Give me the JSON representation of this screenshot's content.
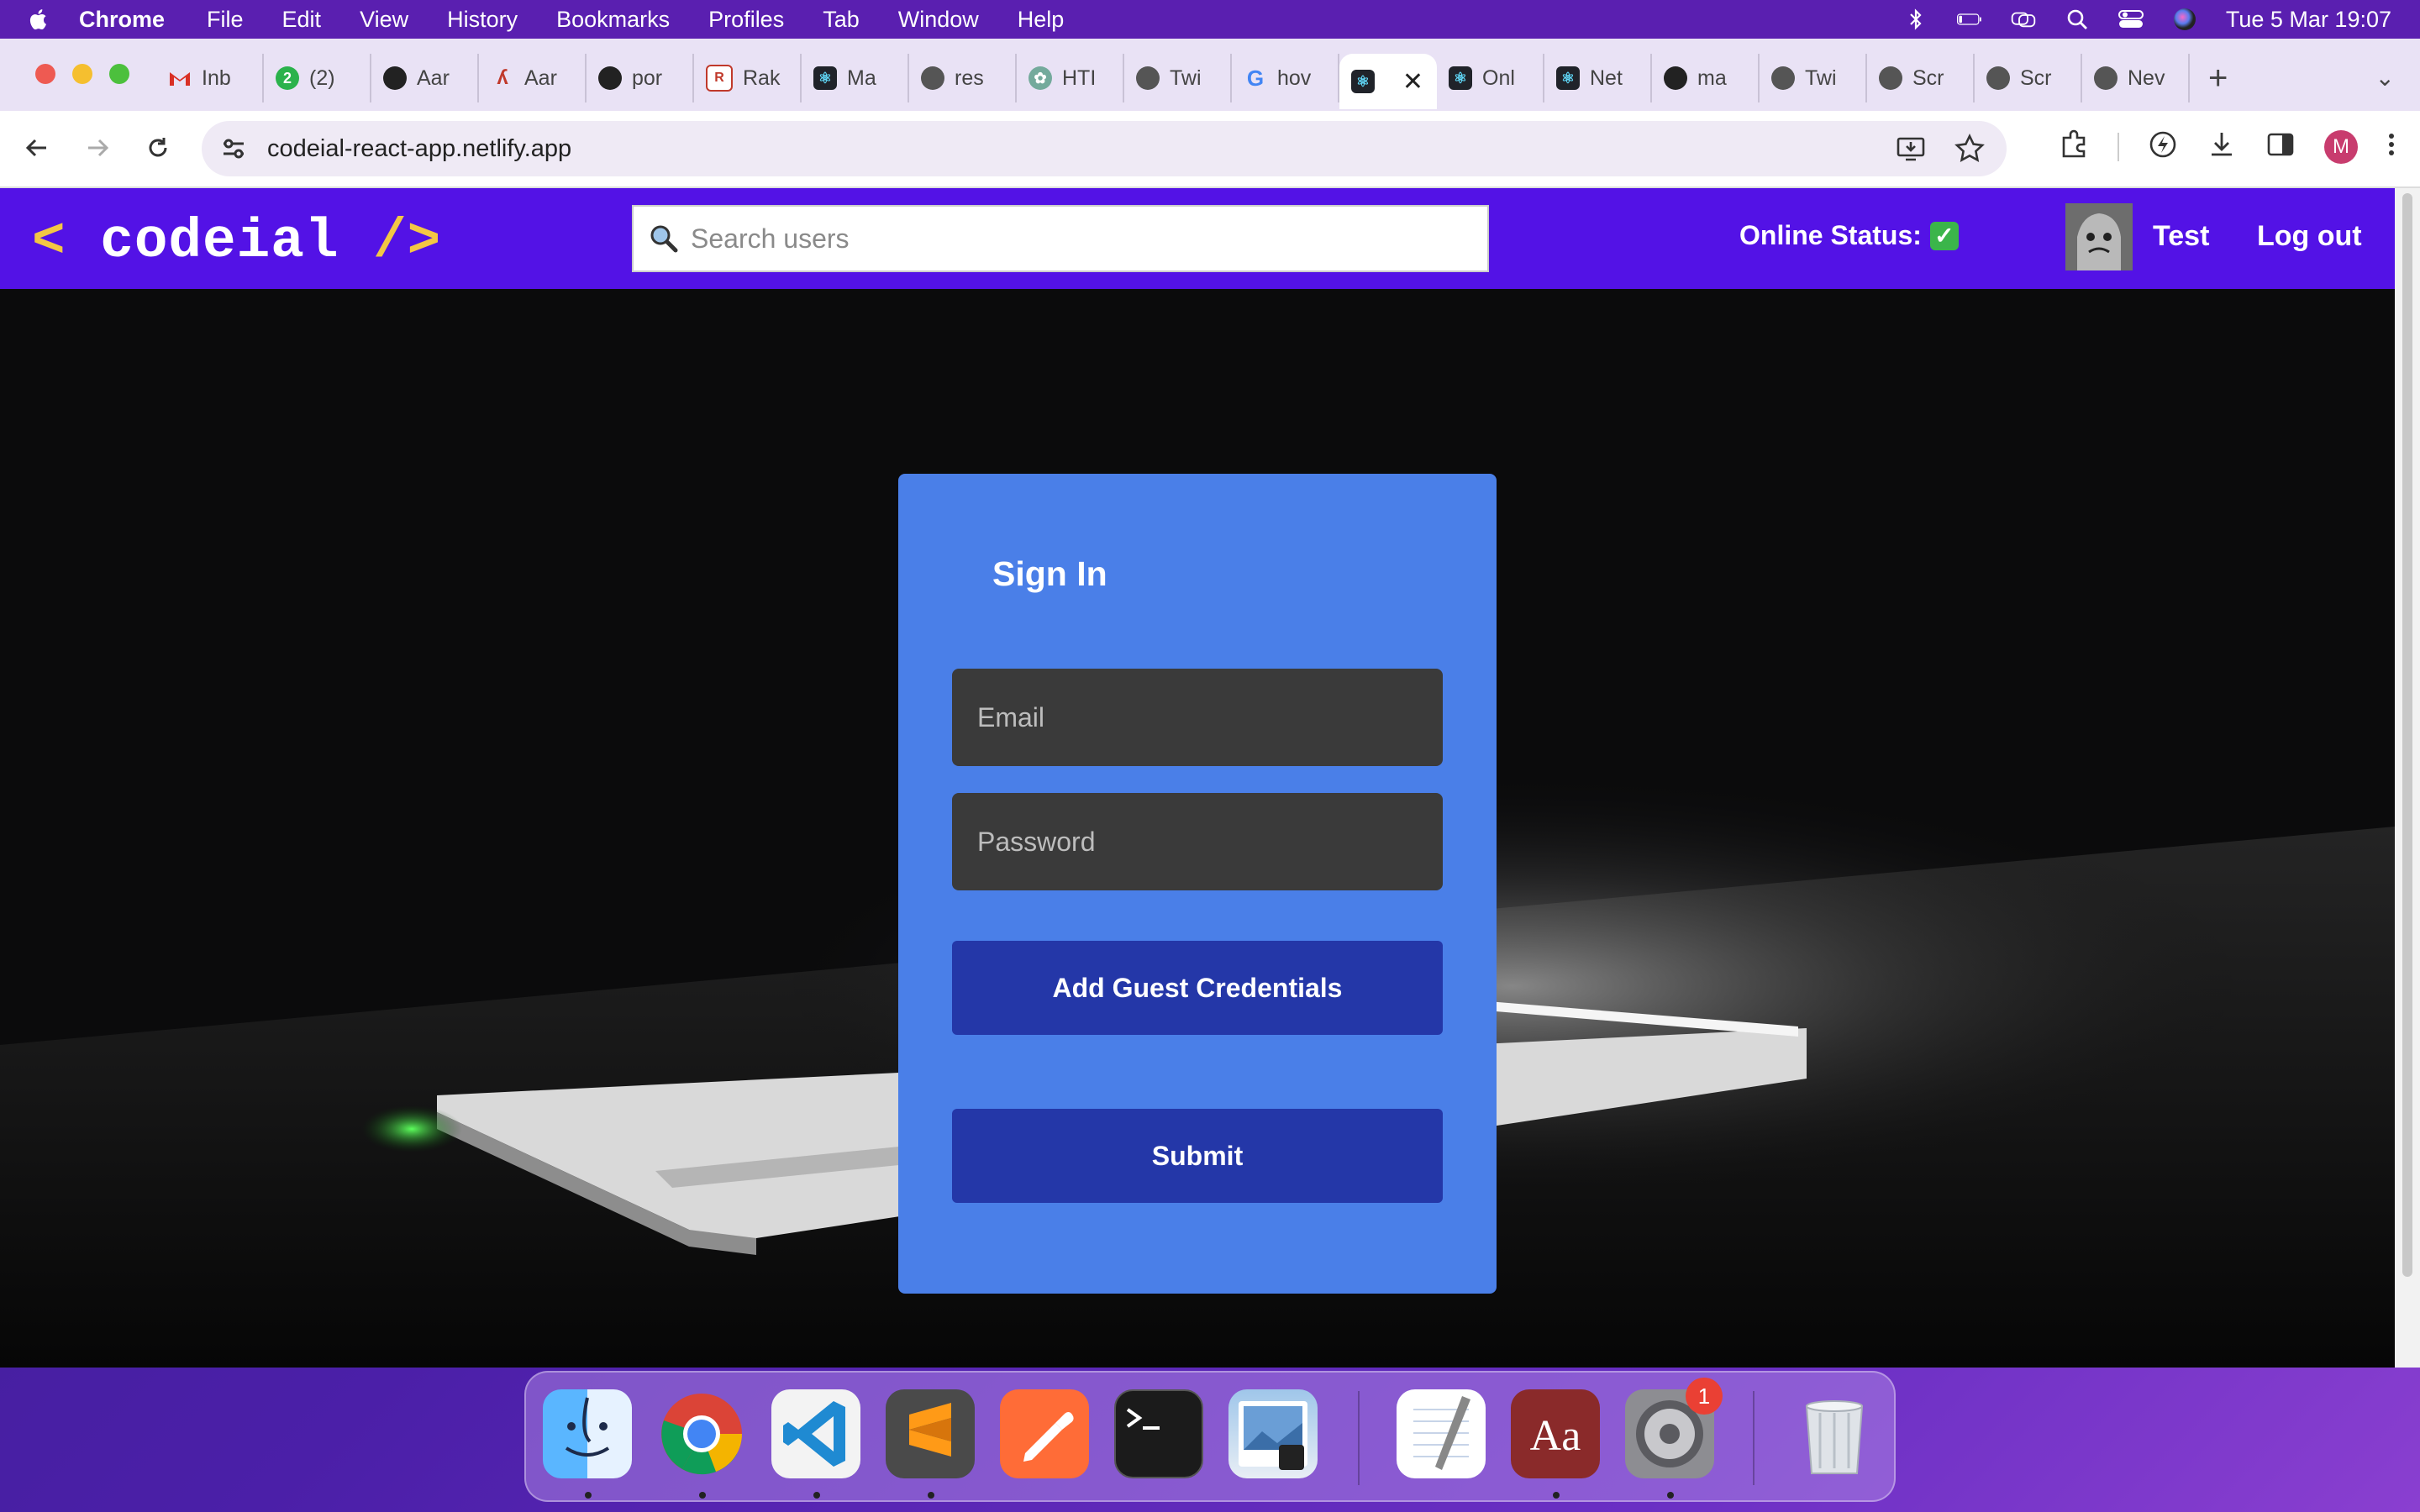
{
  "menubar": {
    "app_name": "Chrome",
    "items": [
      "File",
      "Edit",
      "View",
      "History",
      "Bookmarks",
      "Profiles",
      "Tab",
      "Window",
      "Help"
    ],
    "datetime": "Tue 5 Mar  19:07"
  },
  "browser": {
    "tabs": [
      {
        "title": "Inb",
        "icon": "gmail-icon"
      },
      {
        "title": "(2)",
        "icon": "whatsapp-icon"
      },
      {
        "title": "Aar",
        "icon": "github-icon"
      },
      {
        "title": "Aar",
        "icon": "resume-icon"
      },
      {
        "title": "por",
        "icon": "github-icon"
      },
      {
        "title": "Rak",
        "icon": "rakuten-icon"
      },
      {
        "title": "Ma",
        "icon": "react-icon"
      },
      {
        "title": "res",
        "icon": "globe-icon"
      },
      {
        "title": "HTI",
        "icon": "openai-icon"
      },
      {
        "title": "Twi",
        "icon": "globe-icon"
      },
      {
        "title": "hov",
        "icon": "google-icon"
      },
      {
        "title": "",
        "icon": "react-icon",
        "active": true
      },
      {
        "title": "Onl",
        "icon": "react-icon"
      },
      {
        "title": "Net",
        "icon": "react-icon"
      },
      {
        "title": "ma",
        "icon": "github-icon"
      },
      {
        "title": "Twi",
        "icon": "globe-icon"
      },
      {
        "title": "Scr",
        "icon": "globe-icon"
      },
      {
        "title": "Scr",
        "icon": "globe-icon"
      },
      {
        "title": "Nev",
        "icon": "chrome-icon"
      }
    ],
    "url": "codeial-react-app.netlify.app",
    "profile_initial": "M"
  },
  "app": {
    "logo_open": "<",
    "logo_text": "codeial",
    "logo_close": "/>",
    "search_placeholder": "Search users",
    "online_status_label": "Online Status:",
    "online_status_icon": "✓",
    "username": "Test",
    "logout_label": "Log out"
  },
  "signin": {
    "title": "Sign In",
    "email_placeholder": "Email",
    "password_placeholder": "Password",
    "guest_button": "Add Guest Credentials",
    "submit_button": "Submit"
  },
  "dock": {
    "apps": [
      "finder-icon",
      "chrome-icon",
      "vscode-icon",
      "sublime-text-icon",
      "postman-icon",
      "terminal-icon",
      "preview-icon",
      "textedit-icon",
      "dictionary-icon",
      "system-settings-icon",
      "trash-icon"
    ],
    "settings_badge": "1",
    "dictionary_label": "Aa"
  },
  "colors": {
    "app_header": "#5312e6",
    "card": "#4a7fe8",
    "button": "#2437a8",
    "field": "#3a3a3a",
    "logo_accent": "#f3c744"
  }
}
